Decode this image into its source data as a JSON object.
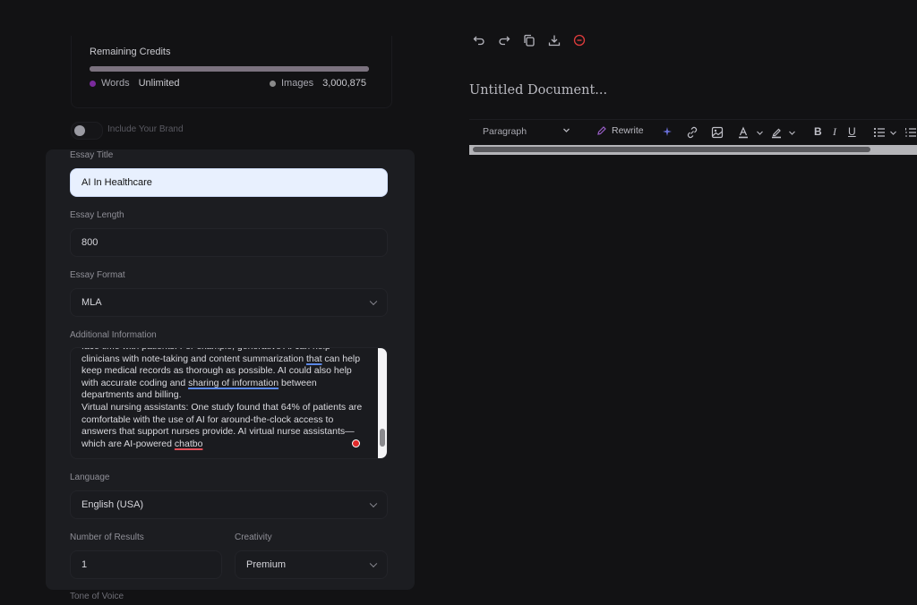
{
  "credits": {
    "title": "Remaining Credits",
    "usage_fraction": 1.0,
    "words_label": "Words",
    "words_value": "Unlimited",
    "images_label": "Images",
    "images_value": "3,000,875",
    "words_dot_color": "#7a2a9c",
    "images_dot_color": "#8a8a8a"
  },
  "brand": {
    "label": "Include Your Brand",
    "enabled": false
  },
  "form": {
    "essay_title_label": "Essay Title",
    "essay_title_value": "AI In Healthcare",
    "essay_length_label": "Essay Length",
    "essay_length_value": "800",
    "essay_format_label": "Essay Format",
    "essay_format_value": "MLA",
    "additional_info_label": "Additional Information",
    "additional_info": {
      "p1a": "face time with patients. For example, generative AI can help clinicians with note-taking and content summarization ",
      "p1b": "that",
      "p1c": " can help keep medical records as thorough as possible. AI could also help with accurate coding and ",
      "p1d": "sharing of information",
      "p1e": " between departments and billing.",
      "p2a": "Virtual nursing assistants: One study found that 64% of patients are comfortable with the use of AI for around-the-clock access to answers that support nurses provide. AI virtual nurse assistants—which are AI-powered ",
      "p2b": "chatbo"
    },
    "language_label": "Language",
    "language_value": "English (USA)",
    "results_label": "Number of Results",
    "results_value": "1",
    "creativity_label": "Creativity",
    "creativity_value": "Premium",
    "tone_label": "Tone of Voice"
  },
  "document": {
    "title": "Untitled Document...",
    "toolbar": {
      "icons": [
        "undo-icon",
        "redo-icon",
        "copy-icon",
        "download-icon",
        "delete-icon"
      ],
      "paragraph_label": "Paragraph",
      "rewrite_label": "Rewrite",
      "bold": "B",
      "italic": "I",
      "underline": "U"
    }
  },
  "colors": {
    "accent": "#7a2a9c",
    "danger": "#e03c3c"
  }
}
